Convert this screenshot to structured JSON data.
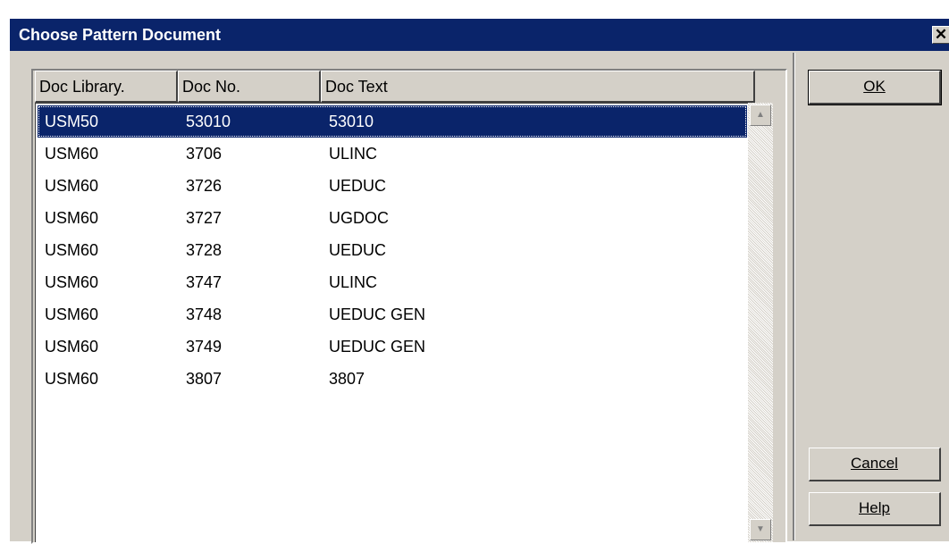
{
  "dialog": {
    "title": "Choose Pattern Document",
    "close_glyph": "✕"
  },
  "table": {
    "columns": [
      "Doc Library.",
      "Doc No.",
      "Doc Text"
    ],
    "rows": [
      {
        "library": "USM50",
        "doc_no": "53010",
        "doc_text": "53010",
        "selected": true
      },
      {
        "library": "USM60",
        "doc_no": "3706",
        "doc_text": "ULINC"
      },
      {
        "library": "USM60",
        "doc_no": "3726",
        "doc_text": "UEDUC"
      },
      {
        "library": "USM60",
        "doc_no": "3727",
        "doc_text": "UGDOC"
      },
      {
        "library": "USM60",
        "doc_no": "3728",
        "doc_text": "UEDUC"
      },
      {
        "library": "USM60",
        "doc_no": "3747",
        "doc_text": "ULINC"
      },
      {
        "library": "USM60",
        "doc_no": "3748",
        "doc_text": "UEDUC GEN"
      },
      {
        "library": "USM60",
        "doc_no": "3749",
        "doc_text": "UEDUC GEN"
      },
      {
        "library": "USM60",
        "doc_no": "3807",
        "doc_text": "3807"
      }
    ]
  },
  "scrollbar": {
    "up_glyph": "▲",
    "down_glyph": "▼"
  },
  "buttons": {
    "ok": {
      "label": "OK"
    },
    "cancel": {
      "label": "Cancel"
    },
    "help": {
      "label": "Help"
    }
  },
  "colors": {
    "selection": "#0a246a",
    "face": "#d4d0c8"
  }
}
